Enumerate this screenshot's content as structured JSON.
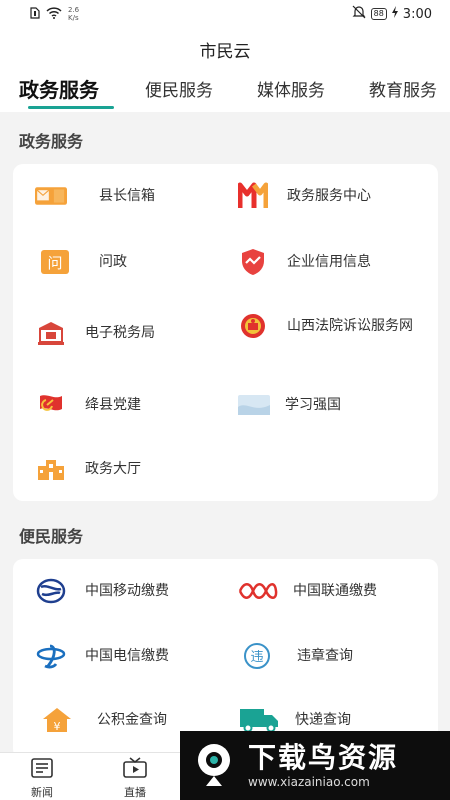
{
  "status_bar": {
    "speed_value": "2.6",
    "speed_unit": "K/s",
    "battery": "88",
    "time": "3:00"
  },
  "header": {
    "title": "市民云"
  },
  "tabs": [
    {
      "label": "政务服务",
      "active": true
    },
    {
      "label": "便民服务"
    },
    {
      "label": "媒体服务"
    },
    {
      "label": "教育服务"
    }
  ],
  "sections": {
    "gov": {
      "title": "政务服务",
      "items": [
        {
          "label": "县长信箱",
          "icon": "mailbox-icon"
        },
        {
          "label": "政务服务中心",
          "icon": "service-center-logo-icon"
        },
        {
          "label": "问政",
          "icon": "ask-government-icon"
        },
        {
          "label": "企业信用信息",
          "icon": "shield-trend-icon"
        },
        {
          "label": "电子税务局",
          "icon": "tax-bureau-icon"
        },
        {
          "label": "山西法院诉讼服务网",
          "icon": "court-emblem-icon"
        },
        {
          "label": "绛县党建",
          "icon": "party-flag-icon"
        },
        {
          "label": "学习强国",
          "icon": "study-app-icon"
        },
        {
          "label": "政务大厅",
          "icon": "government-hall-icon"
        }
      ]
    },
    "convenience": {
      "title": "便民服务",
      "items": [
        {
          "label": "中国移动缴费",
          "icon": "china-mobile-icon"
        },
        {
          "label": "中国联通缴费",
          "icon": "china-unicom-icon"
        },
        {
          "label": "中国电信缴费",
          "icon": "china-telecom-icon"
        },
        {
          "label": "违章查询",
          "icon": "violation-icon"
        },
        {
          "label": "公积金查询",
          "icon": "housing-fund-icon"
        },
        {
          "label": "快递查询",
          "icon": "delivery-truck-icon"
        }
      ]
    }
  },
  "bottom_nav": [
    {
      "label": "新闻",
      "icon": "news-icon"
    },
    {
      "label": "直播",
      "icon": "tv-icon"
    }
  ],
  "watermark": {
    "title": "下载鸟资源",
    "url": "www.xiazainiao.com"
  },
  "colors": {
    "accent": "#1aa394",
    "orange": "#f5a23a",
    "red": "#e23b3b"
  }
}
